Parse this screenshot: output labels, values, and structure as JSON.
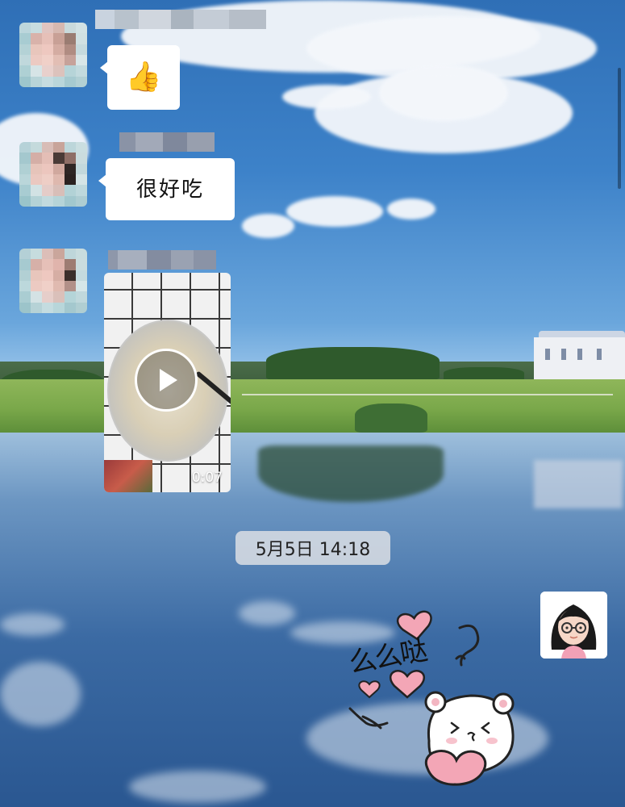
{
  "chat": {
    "messages": [
      {
        "sender": "other",
        "type": "emoji",
        "content": "👍"
      },
      {
        "sender": "other",
        "type": "text",
        "content": "很好吃"
      },
      {
        "sender": "other",
        "type": "video",
        "duration": "0:07"
      }
    ],
    "timestamp": "5月5日 14:18",
    "my_message": {
      "sender": "self",
      "type": "sticker",
      "sticker_text": "么么哒"
    }
  },
  "icons": {
    "thumbs_up": "thumbs-up-emoji",
    "play": "play-icon",
    "my_avatar": "girl-with-glasses-avatar"
  },
  "colors": {
    "bubble_bg": "#ffffff",
    "timestamp_bg": "#d7dce2",
    "heart_pink": "#f2a7b8"
  }
}
